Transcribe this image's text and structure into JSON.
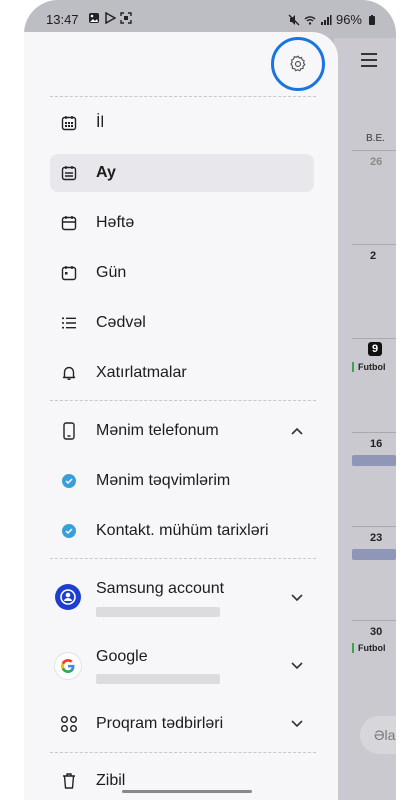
{
  "status_bar": {
    "time": "13:47",
    "battery": "96%"
  },
  "drawer": {
    "view_items": [
      {
        "label": "İl",
        "icon": "calendar-grid-icon"
      },
      {
        "label": "Ay",
        "icon": "calendar-month-icon",
        "selected": true
      },
      {
        "label": "Həftə",
        "icon": "calendar-week-icon"
      },
      {
        "label": "Gün",
        "icon": "calendar-day-icon"
      },
      {
        "label": "Cədvəl",
        "icon": "list-icon"
      },
      {
        "label": "Xatırlatmalar",
        "icon": "bell-icon"
      }
    ],
    "phone_section": {
      "label": "Mənim telefonum",
      "sub_items": [
        {
          "label": "Mənim təqvimlərim"
        },
        {
          "label": "Kontakt. mühüm tarixləri"
        }
      ]
    },
    "accounts": [
      {
        "label": "Samsung account",
        "icon": "samsung-account-icon"
      },
      {
        "label": "Google",
        "icon": "google-icon"
      }
    ],
    "program_events": {
      "label": "Proqram tədbirləri"
    },
    "trash": {
      "label": "Zibil"
    }
  },
  "calendar_background": {
    "day_header": "B.E.",
    "dates": [
      "26",
      "2",
      "9",
      "16",
      "23",
      "30"
    ],
    "event_label": "Futbol",
    "fab_label": "Əla"
  },
  "colors": {
    "accent_highlight": "#1976e0",
    "check": "#3a9fd8",
    "selected_bg": "#e8e8ec"
  }
}
